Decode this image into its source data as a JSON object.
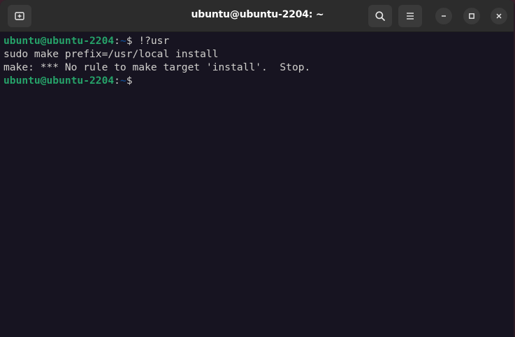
{
  "window": {
    "title": "ubuntu@ubuntu-2204: ~"
  },
  "titlebar": {
    "new_tab_icon": "new-tab-icon",
    "search_icon": "search-icon",
    "menu_icon": "hamburger-menu-icon",
    "minimize_icon": "minimize-icon",
    "maximize_icon": "maximize-icon",
    "close_icon": "close-icon"
  },
  "terminal": {
    "lines": [
      {
        "type": "prompt",
        "user": "ubuntu@ubuntu-2204",
        "sep": ":",
        "path": "~",
        "symbol": "$ ",
        "command": "!?usr"
      },
      {
        "type": "output",
        "text": "sudo make prefix=/usr/local install"
      },
      {
        "type": "output",
        "text": "make: *** No rule to make target 'install'.  Stop."
      },
      {
        "type": "prompt",
        "user": "ubuntu@ubuntu-2204",
        "sep": ":",
        "path": "~",
        "symbol": "$ ",
        "command": ""
      }
    ]
  },
  "colors": {
    "background": "#171421",
    "prompt_user": "#26a269",
    "prompt_path": "#12488b",
    "text": "#d0cfcc",
    "titlebar": "#2c2c2c"
  }
}
